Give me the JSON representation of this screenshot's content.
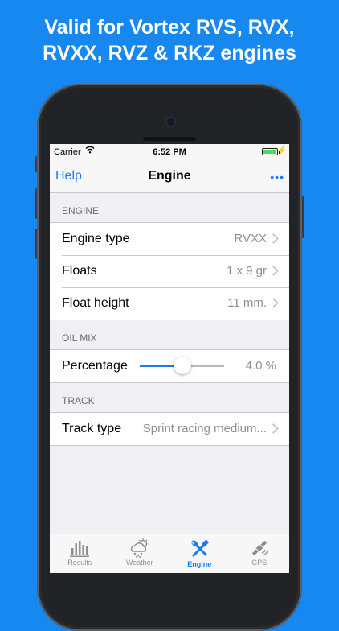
{
  "banner": {
    "line1": "Valid for Vortex RVS, RVX,",
    "line2": "RVXX, RVZ & RKZ engines"
  },
  "status_bar": {
    "carrier": "Carrier",
    "time": "6:52 PM",
    "battery_level": 1.0
  },
  "nav": {
    "left": "Help",
    "title": "Engine",
    "right": "•••"
  },
  "sections": {
    "engine": {
      "header": "ENGINE",
      "rows": [
        {
          "label": "Engine type",
          "value": "RVXX"
        },
        {
          "label": "Floats",
          "value": "1 x 9 gr"
        },
        {
          "label": "Float height",
          "value": "11 mm."
        }
      ]
    },
    "oil_mix": {
      "header": "OIL MIX",
      "label": "Percentage",
      "value": "4.0 %",
      "slider_level": 0.5
    },
    "track": {
      "header": "TRACK",
      "label": "Track type",
      "value": "Sprint racing medium..."
    }
  },
  "tabs": [
    {
      "label": "Results",
      "icon": "bar-chart-icon",
      "active": false
    },
    {
      "label": "Weather",
      "icon": "weather-icon",
      "active": false
    },
    {
      "label": "Engine",
      "icon": "wrench-screwdriver-icon",
      "active": true
    },
    {
      "label": "GPS",
      "icon": "satellite-icon",
      "active": false
    }
  ],
  "colors": {
    "background": "#1688f0",
    "accent": "#1a7bf0",
    "battery": "#4cd964"
  }
}
